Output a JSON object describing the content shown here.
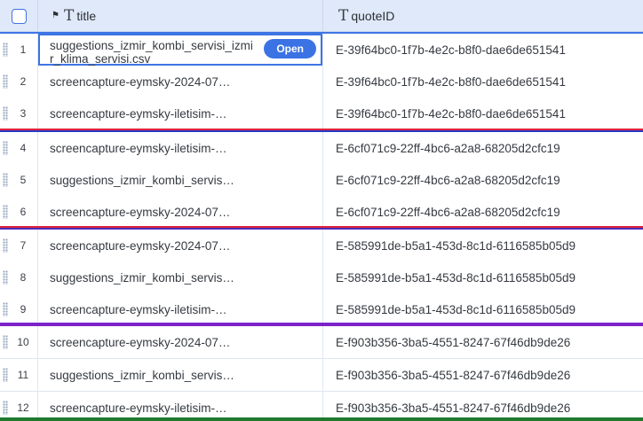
{
  "header": {
    "title_label": "title",
    "quote_label": "quoteID"
  },
  "active_row": {
    "title": "suggestions_izmir_kombi_servisi_izmir_klima_servisi.csv",
    "open_label": "Open"
  },
  "rows": [
    {
      "num": "1",
      "title": "suggestions_izmir_kombi_servisi_izmir_klima_servisi.csv",
      "quote": "E-39f64bc0-1f7b-4e2c-b8f0-dae6de651541"
    },
    {
      "num": "2",
      "title": "screencapture-eymsky-2024-07…",
      "quote": "E-39f64bc0-1f7b-4e2c-b8f0-dae6de651541"
    },
    {
      "num": "3",
      "title": "screencapture-eymsky-iletisim-…",
      "quote": "E-39f64bc0-1f7b-4e2c-b8f0-dae6de651541"
    },
    {
      "num": "4",
      "title": "screencapture-eymsky-iletisim-…",
      "quote": "E-6cf071c9-22ff-4bc6-a2a8-68205d2cfc19"
    },
    {
      "num": "5",
      "title": "suggestions_izmir_kombi_servis…",
      "quote": "E-6cf071c9-22ff-4bc6-a2a8-68205d2cfc19"
    },
    {
      "num": "6",
      "title": "screencapture-eymsky-2024-07…",
      "quote": "E-6cf071c9-22ff-4bc6-a2a8-68205d2cfc19"
    },
    {
      "num": "7",
      "title": "screencapture-eymsky-2024-07…",
      "quote": "E-585991de-b5a1-453d-8c1d-6116585b05d9"
    },
    {
      "num": "8",
      "title": "suggestions_izmir_kombi_servis…",
      "quote": "E-585991de-b5a1-453d-8c1d-6116585b05d9"
    },
    {
      "num": "9",
      "title": "screencapture-eymsky-iletisim-…",
      "quote": "E-585991de-b5a1-453d-8c1d-6116585b05d9"
    },
    {
      "num": "10",
      "title": "screencapture-eymsky-2024-07…",
      "quote": "E-f903b356-3ba5-4551-8247-67f46db9de26"
    },
    {
      "num": "11",
      "title": "suggestions_izmir_kombi_servis…",
      "quote": "E-f903b356-3ba5-4551-8247-67f46db9de26"
    },
    {
      "num": "12",
      "title": "screencapture-eymsky-iletisim-…",
      "quote": "E-f903b356-3ba5-4551-8247-67f46db9de26"
    }
  ],
  "group_separator_colors": [
    {
      "top": "#e0243a",
      "bottom": "#2a39c6"
    },
    {
      "top": "#e0243a",
      "bottom": "#4b2ab8"
    },
    {
      "top": "#7b22c9",
      "bottom": "#7b22c9"
    },
    {
      "top": "#1f7a2e",
      "bottom": "#1f7a2e"
    }
  ]
}
